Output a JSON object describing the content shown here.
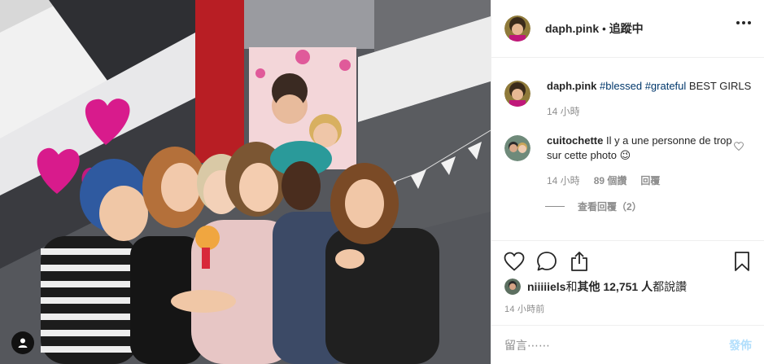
{
  "post": {
    "username": "daph.pink",
    "separator": "•",
    "follow_status": "追蹤中",
    "more_icon": "more-options-icon"
  },
  "caption": {
    "username": "daph.pink",
    "tag1": "#blessed",
    "tag2": "#grateful",
    "text": " BEST GIRLS",
    "time": "14 小時"
  },
  "comment": {
    "username": "cuitochette",
    "text": " Il y a une personne de trop sur cette photo 😉",
    "time": "14 小時",
    "likes": "89 個讚",
    "reply": "回覆",
    "view_replies": "查看回覆（2）"
  },
  "likes": {
    "user": "niiiiiels",
    "and": " 和 ",
    "others": "其他 12,751 人",
    "suffix": " 都說讚"
  },
  "timestamp": "14 小時前",
  "add_comment": {
    "placeholder": "留言⋯⋯",
    "post_label": "發佈"
  },
  "colors": {
    "link": "#00376b",
    "meta": "#8e8e8e",
    "post_disabled": "#b2dffc",
    "balloon": "#d81b8c"
  }
}
